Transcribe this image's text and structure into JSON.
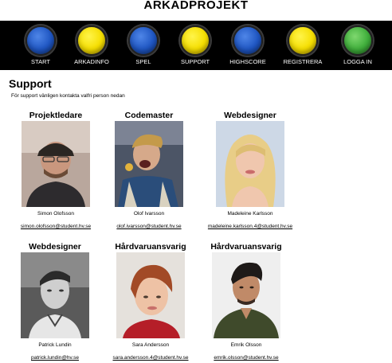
{
  "site": {
    "title": "ARKADPROJEKT"
  },
  "nav": [
    {
      "label": "START",
      "color": "#1f56c2"
    },
    {
      "label": "ARKADINFO",
      "color": "#f5de00"
    },
    {
      "label": "SPEL",
      "color": "#1f56c2"
    },
    {
      "label": "SUPPORT",
      "color": "#f5de00"
    },
    {
      "label": "HIGHSCORE",
      "color": "#1f56c2"
    },
    {
      "label": "REGISTRERA",
      "color": "#f5de00"
    },
    {
      "label": "LOGGA IN",
      "color": "#3fae3b"
    }
  ],
  "page": {
    "heading": "Support",
    "intro": "För support vänligen kontakta valfri person nedan"
  },
  "people": [
    {
      "role": "Projektledare",
      "name": "Simon Olofsson",
      "email": "simon.olofsson@student.hv.se"
    },
    {
      "role": "Codemaster",
      "name": "Olof Ivarsson",
      "email": "olof.ivarsson@student.hv.se"
    },
    {
      "role": "Webdesigner",
      "name": "Madeleine Karlsson",
      "email": "madeleine.karlsson.4@student.hv.se"
    },
    {
      "role": "Webdesigner",
      "name": "Patrick Lundin",
      "email": "patrick.lundin@hv.se"
    },
    {
      "role": "Hårdvaruansvarig",
      "name": "Sara Andersson",
      "email": "sara.andersson.4@student.hv.se"
    },
    {
      "role": "Hårdvaruansvarig",
      "name": "Emrik Olsson",
      "email": "emrik.olsson@student.hv.se"
    }
  ]
}
